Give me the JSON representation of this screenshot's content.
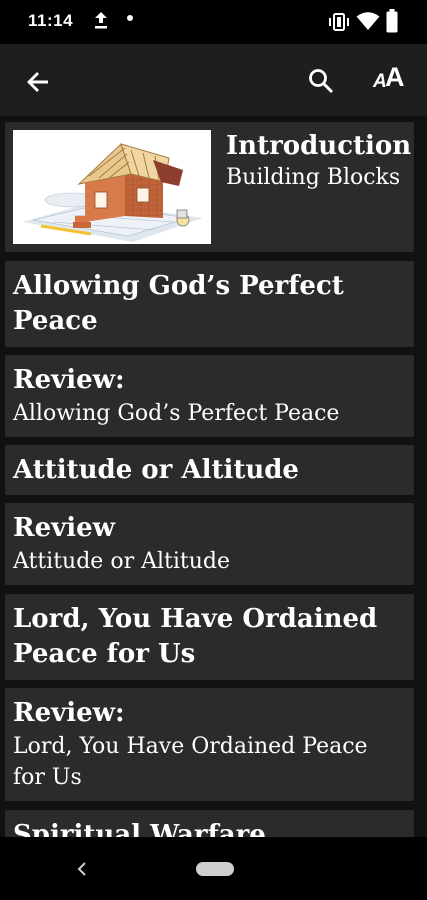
{
  "status_bar": {
    "time": "11:14"
  },
  "toolbar": {
    "font_small": "A",
    "font_big": "A"
  },
  "chapters": [
    {
      "title": "Introduction",
      "subtitle": "Building Blocks"
    },
    {
      "title": "Allowing God’s Perfect Peace",
      "subtitle": ""
    },
    {
      "title": "Review:",
      "subtitle": "Allowing God’s Perfect Peace"
    },
    {
      "title": "Attitude or Altitude",
      "subtitle": ""
    },
    {
      "title": "Review",
      "subtitle": "Attitude or Altitude"
    },
    {
      "title": "Lord, You Have Ordained Peace for Us",
      "subtitle": ""
    },
    {
      "title": "Review:",
      "subtitle": "Lord, You Have Ordained Peace for Us"
    },
    {
      "title": "Spiritual Warfare",
      "subtitle": ""
    }
  ],
  "colors": {
    "background": "#111111",
    "card": "#2b2b2b",
    "app_bar": "#1e1e1e",
    "text": "#ffffff"
  }
}
